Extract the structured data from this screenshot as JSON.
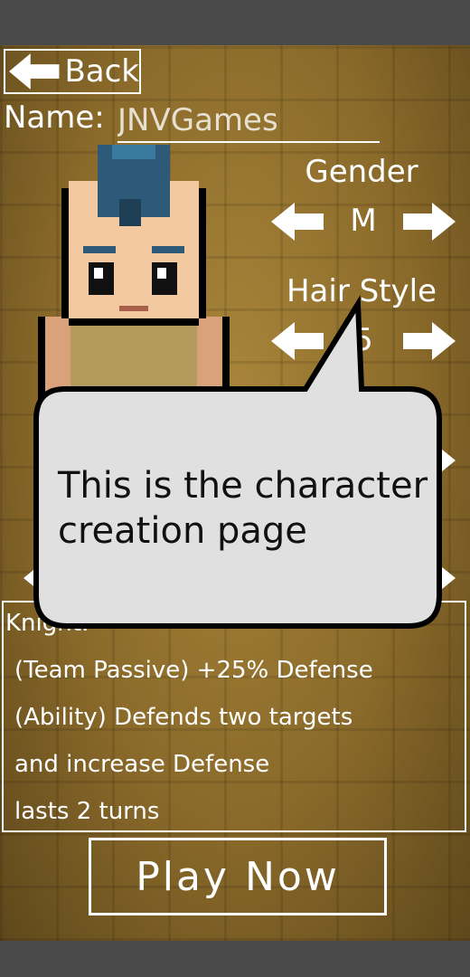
{
  "header": {
    "back_label": "Back"
  },
  "name": {
    "label": "Name:",
    "value": "JNVGames"
  },
  "gender": {
    "title": "Gender",
    "value": "M"
  },
  "hair_style": {
    "title": "Hair Style",
    "value": "5"
  },
  "class_description": {
    "class_name": "Knight:",
    "lines": [
      "(Team Passive) +25% Defense",
      "(Ability) Defends two targets",
      "and increase Defense",
      "lasts 2 turns"
    ]
  },
  "play_label": "Play Now",
  "tutorial": {
    "text": "This is the character creation page"
  },
  "colors": {
    "background": "#8a6a2a",
    "frame": "#4a4a4a",
    "bubble": "#e0e0e0"
  },
  "icons": [
    "left-arrow-icon",
    "right-arrow-icon",
    "back-arrow-icon"
  ]
}
